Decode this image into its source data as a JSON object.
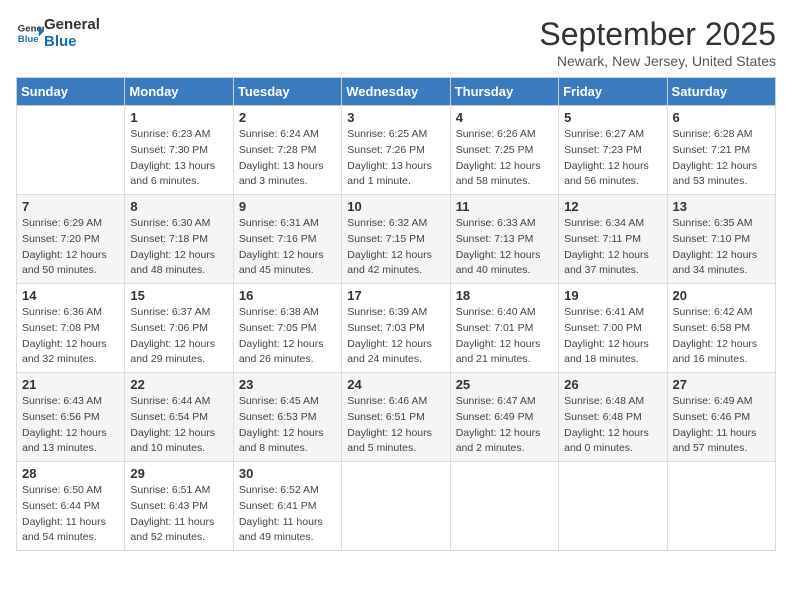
{
  "logo": {
    "line1": "General",
    "line2": "Blue"
  },
  "title": "September 2025",
  "subtitle": "Newark, New Jersey, United States",
  "weekdays": [
    "Sunday",
    "Monday",
    "Tuesday",
    "Wednesday",
    "Thursday",
    "Friday",
    "Saturday"
  ],
  "weeks": [
    [
      {
        "day": "",
        "info": ""
      },
      {
        "day": "1",
        "info": "Sunrise: 6:23 AM\nSunset: 7:30 PM\nDaylight: 13 hours\nand 6 minutes."
      },
      {
        "day": "2",
        "info": "Sunrise: 6:24 AM\nSunset: 7:28 PM\nDaylight: 13 hours\nand 3 minutes."
      },
      {
        "day": "3",
        "info": "Sunrise: 6:25 AM\nSunset: 7:26 PM\nDaylight: 13 hours\nand 1 minute."
      },
      {
        "day": "4",
        "info": "Sunrise: 6:26 AM\nSunset: 7:25 PM\nDaylight: 12 hours\nand 58 minutes."
      },
      {
        "day": "5",
        "info": "Sunrise: 6:27 AM\nSunset: 7:23 PM\nDaylight: 12 hours\nand 56 minutes."
      },
      {
        "day": "6",
        "info": "Sunrise: 6:28 AM\nSunset: 7:21 PM\nDaylight: 12 hours\nand 53 minutes."
      }
    ],
    [
      {
        "day": "7",
        "info": "Sunrise: 6:29 AM\nSunset: 7:20 PM\nDaylight: 12 hours\nand 50 minutes."
      },
      {
        "day": "8",
        "info": "Sunrise: 6:30 AM\nSunset: 7:18 PM\nDaylight: 12 hours\nand 48 minutes."
      },
      {
        "day": "9",
        "info": "Sunrise: 6:31 AM\nSunset: 7:16 PM\nDaylight: 12 hours\nand 45 minutes."
      },
      {
        "day": "10",
        "info": "Sunrise: 6:32 AM\nSunset: 7:15 PM\nDaylight: 12 hours\nand 42 minutes."
      },
      {
        "day": "11",
        "info": "Sunrise: 6:33 AM\nSunset: 7:13 PM\nDaylight: 12 hours\nand 40 minutes."
      },
      {
        "day": "12",
        "info": "Sunrise: 6:34 AM\nSunset: 7:11 PM\nDaylight: 12 hours\nand 37 minutes."
      },
      {
        "day": "13",
        "info": "Sunrise: 6:35 AM\nSunset: 7:10 PM\nDaylight: 12 hours\nand 34 minutes."
      }
    ],
    [
      {
        "day": "14",
        "info": "Sunrise: 6:36 AM\nSunset: 7:08 PM\nDaylight: 12 hours\nand 32 minutes."
      },
      {
        "day": "15",
        "info": "Sunrise: 6:37 AM\nSunset: 7:06 PM\nDaylight: 12 hours\nand 29 minutes."
      },
      {
        "day": "16",
        "info": "Sunrise: 6:38 AM\nSunset: 7:05 PM\nDaylight: 12 hours\nand 26 minutes."
      },
      {
        "day": "17",
        "info": "Sunrise: 6:39 AM\nSunset: 7:03 PM\nDaylight: 12 hours\nand 24 minutes."
      },
      {
        "day": "18",
        "info": "Sunrise: 6:40 AM\nSunset: 7:01 PM\nDaylight: 12 hours\nand 21 minutes."
      },
      {
        "day": "19",
        "info": "Sunrise: 6:41 AM\nSunset: 7:00 PM\nDaylight: 12 hours\nand 18 minutes."
      },
      {
        "day": "20",
        "info": "Sunrise: 6:42 AM\nSunset: 6:58 PM\nDaylight: 12 hours\nand 16 minutes."
      }
    ],
    [
      {
        "day": "21",
        "info": "Sunrise: 6:43 AM\nSunset: 6:56 PM\nDaylight: 12 hours\nand 13 minutes."
      },
      {
        "day": "22",
        "info": "Sunrise: 6:44 AM\nSunset: 6:54 PM\nDaylight: 12 hours\nand 10 minutes."
      },
      {
        "day": "23",
        "info": "Sunrise: 6:45 AM\nSunset: 6:53 PM\nDaylight: 12 hours\nand 8 minutes."
      },
      {
        "day": "24",
        "info": "Sunrise: 6:46 AM\nSunset: 6:51 PM\nDaylight: 12 hours\nand 5 minutes."
      },
      {
        "day": "25",
        "info": "Sunrise: 6:47 AM\nSunset: 6:49 PM\nDaylight: 12 hours\nand 2 minutes."
      },
      {
        "day": "26",
        "info": "Sunrise: 6:48 AM\nSunset: 6:48 PM\nDaylight: 12 hours\nand 0 minutes."
      },
      {
        "day": "27",
        "info": "Sunrise: 6:49 AM\nSunset: 6:46 PM\nDaylight: 11 hours\nand 57 minutes."
      }
    ],
    [
      {
        "day": "28",
        "info": "Sunrise: 6:50 AM\nSunset: 6:44 PM\nDaylight: 11 hours\nand 54 minutes."
      },
      {
        "day": "29",
        "info": "Sunrise: 6:51 AM\nSunset: 6:43 PM\nDaylight: 11 hours\nand 52 minutes."
      },
      {
        "day": "30",
        "info": "Sunrise: 6:52 AM\nSunset: 6:41 PM\nDaylight: 11 hours\nand 49 minutes."
      },
      {
        "day": "",
        "info": ""
      },
      {
        "day": "",
        "info": ""
      },
      {
        "day": "",
        "info": ""
      },
      {
        "day": "",
        "info": ""
      }
    ]
  ]
}
